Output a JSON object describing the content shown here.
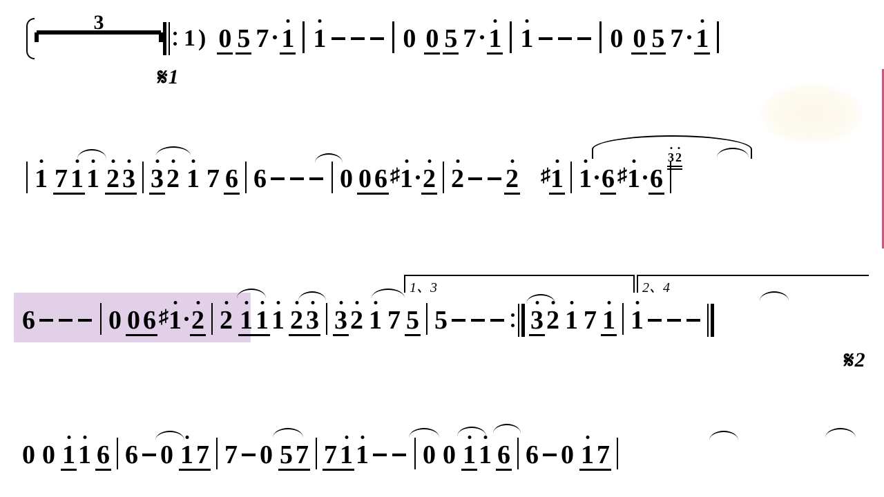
{
  "notation_system": "jianpu-numbered-musical-notation",
  "tuplet_label": "3",
  "segno_labels": {
    "first": "1",
    "second": "2"
  },
  "volta_labels": {
    "first": "1、3",
    "second": "2、4"
  },
  "grace_pair": "32",
  "highlight_range": "line3-bars-1-2",
  "lines": [
    {
      "bars": [
        {
          "anacrusis": true,
          "repeat_start": true,
          "notes": "( ‖: 1 ) 0 5 7 · i"
        },
        {
          "notes": "i - - -"
        },
        {
          "notes": "0 0 5 7 · i"
        },
        {
          "notes": "i - - -"
        },
        {
          "notes": "0 0 5 7 · i"
        }
      ]
    },
    {
      "bars": [
        {
          "notes": "i 7 i i 2̇ 3̇",
          "ties": [
            "7-i",
            "2-3"
          ]
        },
        {
          "notes": "3̇ 2̇ i 7 6",
          "ties": [
            "3-prev",
            "6-next"
          ]
        },
        {
          "notes": "6 - - -"
        },
        {
          "notes": "0 0 6 #i · 2̇"
        },
        {
          "notes": "2̇ - - 2̇ (3̇2̇) #i",
          "slur_wide": true,
          "ties": [
            "2-prev",
            "i-next"
          ]
        },
        {
          "notes": "i · 6 #i · 6"
        }
      ]
    },
    {
      "bars": [
        {
          "highlighted": true,
          "notes": "6 - - -"
        },
        {
          "highlighted": true,
          "notes": "0 0 6 #i · 2̇"
        },
        {
          "notes": "2̇ i i i 2̇ 3̇",
          "ties": [
            "2-prev",
            "i-i",
            "2-3"
          ]
        },
        {
          "volta": "1,3",
          "notes": "3̇ 2̇ i 7 5",
          "ties": [
            "3-prev",
            "5-next"
          ]
        },
        {
          "notes": "5 - - - :",
          "repeat_end": true
        },
        {
          "volta": "2,4",
          "notes": "3̇ 2̇ i 7 i",
          "ties": [
            "3-prev",
            "i-next"
          ]
        },
        {
          "notes": "i - - -",
          "final_bar": true
        }
      ]
    },
    {
      "bars": [
        {
          "notes": "0 0 i i 6",
          "ties": [
            "6-next"
          ]
        },
        {
          "notes": "6 - 0 i 7",
          "ties": [
            "1-7"
          ]
        },
        {
          "notes": "7 - 0 5 7",
          "ties": [
            "5-7"
          ]
        },
        {
          "notes": "7 i i - -",
          "ties": [
            "7-i-prev",
            "7-i"
          ]
        },
        {
          "notes": "0 0 i i 6",
          "ties": [
            "6-next"
          ]
        },
        {
          "notes": "6 - 0 i 7",
          "ties": [
            "1-7"
          ]
        }
      ]
    }
  ]
}
